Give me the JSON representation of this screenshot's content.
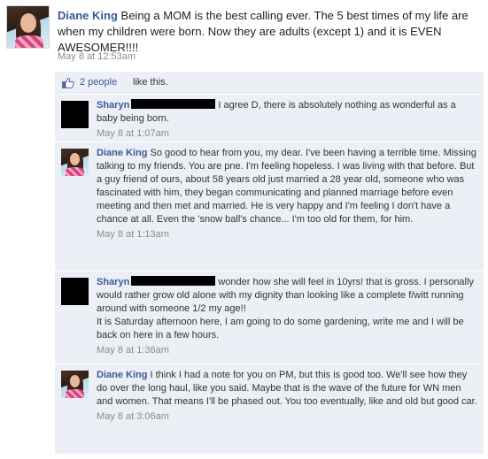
{
  "post": {
    "author": "Diane King",
    "text": "Being a MOM is the best calling ever. The 5 best times of my life are when my children were born. Now they are adults (except 1) and it is EVEN AWESOMER!!!!",
    "timestamp": "May 8 at 12:53am"
  },
  "likes": {
    "link_text": "2 people",
    "rest_text": "like this."
  },
  "comments": [
    {
      "author": "Sharyn",
      "redacted": true,
      "text": "I agree D, there is absolutely nothing as wonderful as a baby being born.",
      "timestamp": "May 8 at 1:07am"
    },
    {
      "author": "Diane King",
      "redacted": false,
      "text": "So good to hear from you, my dear. I've been having a terrible time. Missing talking to my friends. You are pne. I'm feeling hopeless. I was living with that before. But a guy friend of ours, about 58 years old just married a 28 year old, someone who was fascinated with him, they began communicating and planned marriage before even meeting and then met and married. He is very happy and I'm feeling I don't have a chance at all. Even the 'snow ball's chance... I'm too old for them, for him.",
      "timestamp": "May 8 at 1:13am"
    },
    {
      "author": "Sharyn",
      "redacted": true,
      "text": "wonder how she will feel in 10yrs! that is gross. I personally would rather grow old alone with my dignity than looking like a complete f/witt running around with someone 1/2 my age!!",
      "text2": "It is Saturday afternoon here, I am going to do some gardening, write me and I will be back on here in a few hours.",
      "timestamp": "May 8 at 1:36am"
    },
    {
      "author": "Diane King",
      "redacted": false,
      "text": "I think I had a note for you on PM, but this is good too. We'll see how they do over the long haul, like you said. Maybe that is the wave of the future for WN men and women. That means I'll be phased out. You too eventually, like and old but good car.",
      "timestamp": "May 8 at 3:06am"
    }
  ],
  "colors": {
    "link": "#3b5998",
    "comment_bg": "#eceff5",
    "timestamp": "#8c8c8c"
  },
  "icons": {
    "like": "thumbs-up-icon"
  }
}
